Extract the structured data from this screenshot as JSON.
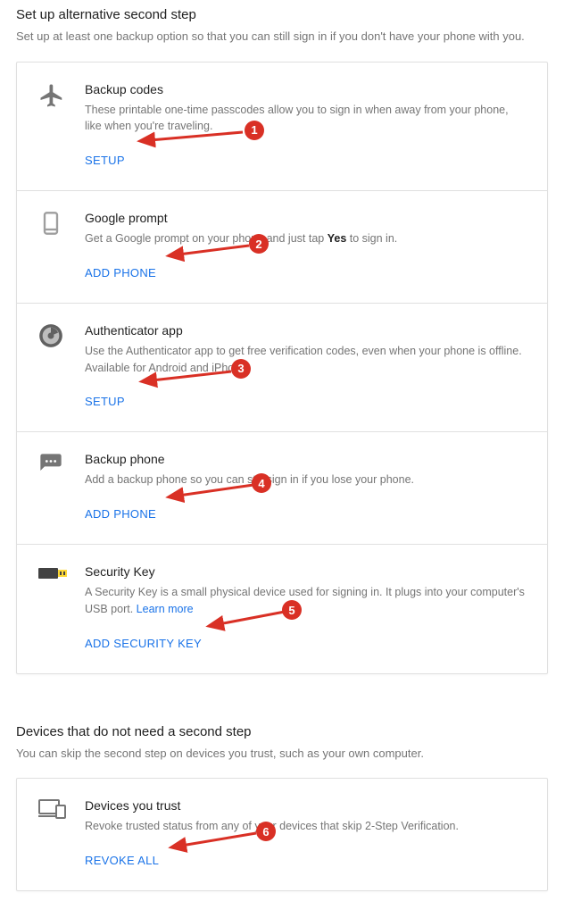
{
  "section1": {
    "title": "Set up alternative second step",
    "subtitle": "Set up at least one backup option so that you can still sign in if you don't have your phone with you."
  },
  "rows": {
    "backup_codes": {
      "title": "Backup codes",
      "desc": "These printable one-time passcodes allow you to sign in when away from your phone, like when you're traveling.",
      "action": "SETUP"
    },
    "google_prompt": {
      "title": "Google prompt",
      "desc_pre": "Get a Google prompt on your phone and just tap ",
      "desc_bold": "Yes",
      "desc_post": " to sign in.",
      "action": "ADD PHONE"
    },
    "authenticator": {
      "title": "Authenticator app",
      "desc": "Use the Authenticator app to get free verification codes, even when your phone is offline. Available for Android and iPhone.",
      "action": "SETUP"
    },
    "backup_phone": {
      "title": "Backup phone",
      "desc": "Add a backup phone so you can still sign in if you lose your phone.",
      "action": "ADD PHONE"
    },
    "security_key": {
      "title": "Security Key",
      "desc_pre": "A Security Key is a small physical device used for signing in. It plugs into your computer's USB port. ",
      "learn_more": "Learn more",
      "action": "ADD SECURITY KEY"
    }
  },
  "section2": {
    "title": "Devices that do not need a second step",
    "subtitle": "You can skip the second step on devices you trust, such as your own computer."
  },
  "trusted": {
    "title": "Devices you trust",
    "desc": "Revoke trusted status from any of your devices that skip 2-Step Verification.",
    "action": "REVOKE ALL"
  },
  "annotations": {
    "n1": "1",
    "n2": "2",
    "n3": "3",
    "n4": "4",
    "n5": "5",
    "n6": "6"
  }
}
